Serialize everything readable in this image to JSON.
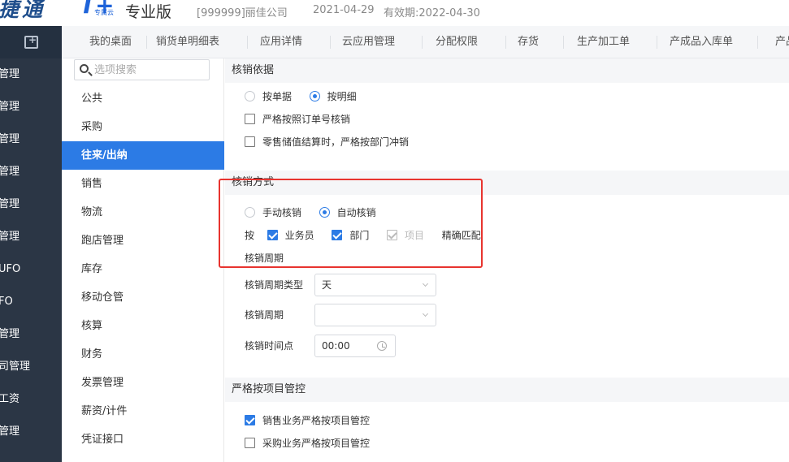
{
  "header": {
    "brand": "捷通",
    "logo_mark": "T+",
    "logo_sub": "专属云",
    "edition": "专业版",
    "company": "[999999]丽佳公司",
    "date": "2021-04-29",
    "expiry": "有效期:2022-04-30"
  },
  "modules": [
    "管理",
    "管理",
    "管理",
    "管理",
    "管理",
    "管理",
    "UFO",
    "FO",
    "管理",
    "司管理",
    "工资",
    "管理"
  ],
  "tabs": [
    "我的桌面",
    "销货单明细表",
    "应用详情",
    "云应用管理",
    "分配权限",
    "存货",
    "生产加工单",
    "产成品入库单",
    "产品"
  ],
  "search": {
    "placeholder": "选项搜索"
  },
  "options": [
    "公共",
    "采购",
    "往来/出纳",
    "销售",
    "物流",
    "跑店管理",
    "库存",
    "移动仓管",
    "核算",
    "财务",
    "发票管理",
    "薪资/计件",
    "凭证接口"
  ],
  "sections": {
    "basis": {
      "title": "核销依据",
      "radio_bill": "按单据",
      "radio_detail": "按明细",
      "check_order": "严格按照订单号核销",
      "check_retail": "零售储值结算时，严格按部门冲销"
    },
    "method": {
      "title": "核销方式",
      "radio_manual": "手动核销",
      "radio_auto": "自动核销",
      "by": "按",
      "check_salesman": "业务员",
      "check_dept": "部门",
      "check_project": "项目",
      "exact_match": "精确匹配",
      "cycle_title": "核销周期",
      "cycle_type_label": "核销周期类型",
      "cycle_type_value": "天",
      "cycle_label": "核销周期",
      "cycle_value": "",
      "time_label": "核销时间点",
      "time_value": "00:00"
    },
    "project": {
      "title": "严格按项目管控",
      "check_sales": "销售业务严格按项目管控",
      "check_purchase": "采购业务严格按项目管控"
    }
  },
  "colors": {
    "accent": "#2c7be5",
    "module_bar": "#2b3645",
    "highlight_box": "#e8342f"
  }
}
